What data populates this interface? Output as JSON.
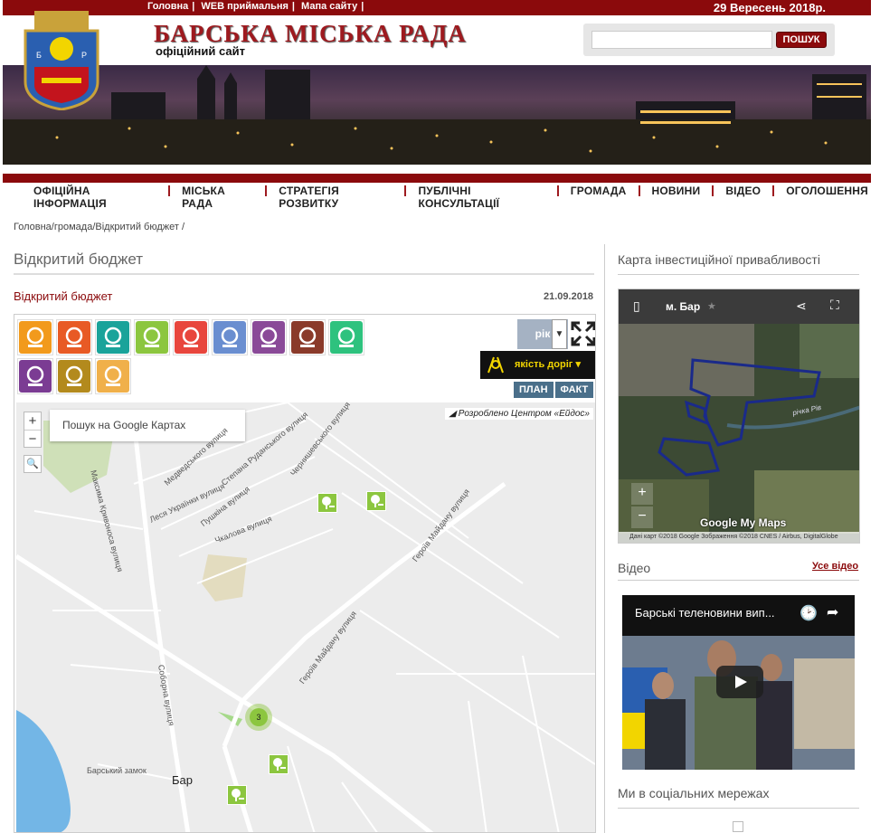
{
  "topbar": {
    "links": [
      "Головна",
      "WEB приймальня",
      "Мапа сайту"
    ],
    "date": "29 Вересень 2018р."
  },
  "header": {
    "title": "БАРСЬКА МІСЬКА РАДА",
    "subtitle": "офіційний сайт",
    "search_button": "ПОШУК",
    "search_value": ""
  },
  "nav": [
    "ОФІЦІЙНА ІНФОРМАЦІЯ",
    "МІСЬКА РАДА",
    "СТРАТЕГІЯ РОЗВИТКУ",
    "ПУБЛІЧНІ КОНСУЛЬТАЦІЇ",
    "ГРОМАДА",
    "НОВИНИ",
    "ВІДЕО",
    "ОГОЛОШЕННЯ"
  ],
  "breadcrumb": "Головна/громада/Відкритий бюджет /",
  "page": {
    "title": "Відкритий бюджет",
    "article_title": "Відкритий бюджет",
    "article_date": "21.09.2018"
  },
  "budget_widget": {
    "categories": [
      {
        "icon": "education-icon",
        "color": "#f29a1c"
      },
      {
        "icon": "social-icon",
        "color": "#e85a25"
      },
      {
        "icon": "roads-icon",
        "color": "#1aa39a"
      },
      {
        "icon": "park-icon",
        "color": "#8cc63f"
      },
      {
        "icon": "health-icon",
        "color": "#e8463d"
      },
      {
        "icon": "sport-icon",
        "color": "#6a8ed0"
      },
      {
        "icon": "culture-icon",
        "color": "#8a4a98"
      },
      {
        "icon": "tourism-icon",
        "color": "#8a3a2a"
      },
      {
        "icon": "ecology-icon",
        "color": "#2ec27e"
      },
      {
        "icon": "lighting-icon",
        "color": "#7b3c93"
      },
      {
        "icon": "utilities-icon",
        "color": "#b38a1d"
      },
      {
        "icon": "playground-icon",
        "color": "#f0b04a"
      }
    ],
    "period": "рік",
    "quality_label": "якість доріг",
    "plan_label": "ПЛАН",
    "fact_label": "ФАКТ",
    "map_search_placeholder": "Пошук на Google Картах",
    "credit": "Розроблено Центром «Ейдос»",
    "cluster_count": "3",
    "zoom_in": "+",
    "zoom_out": "−",
    "street_labels": [
      "Героїв Майдану вулиця",
      "Героїв Майдану вулиця",
      "Соборна вулиця",
      "Леся Українки вулиця",
      "Степана Руданського вулиця",
      "Пушкіна вулиця",
      "Чкалова вулиця",
      "Медведського вулиця",
      "Чернишевського вулиця",
      "Максима Кривоноса вулиця",
      "Барський замок",
      "Бар"
    ]
  },
  "sidebar": {
    "invest_map_title": "Карта інвестиційної привабливості",
    "mymap_title": "м. Бар",
    "mymap_river": "річка Рів",
    "mymap_footer": "Дані карт ©2018 Google Зображення ©2018 CNES / Airbus, DigitalGlobe",
    "mymap_logo": "Google My Maps",
    "video_title": "Відео",
    "all_video": "Усе відео",
    "video_caption": "Барські теленовини вип...",
    "social_title": "Ми в соціальних мережах"
  }
}
